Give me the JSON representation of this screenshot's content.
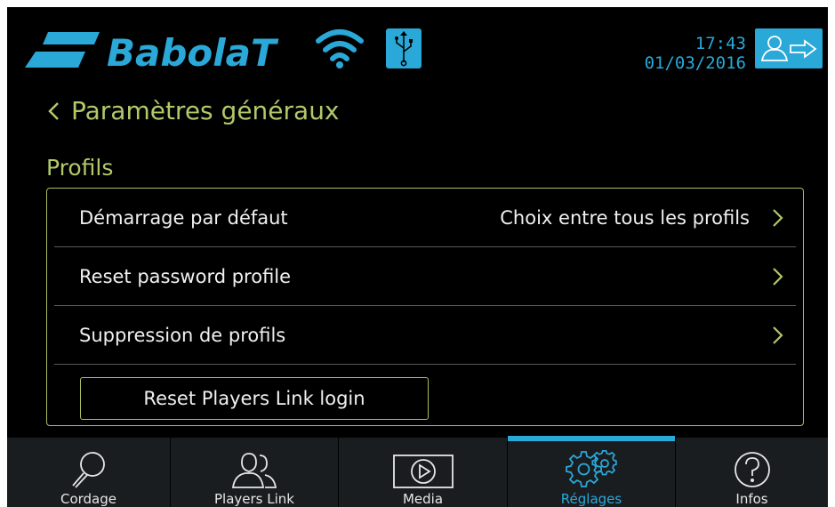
{
  "header": {
    "brand": "BabolaT",
    "time": "17:43",
    "date": "01/03/2016",
    "icons": [
      "babolat-logo",
      "wifi-icon",
      "usb-icon",
      "logout-icon"
    ]
  },
  "title": {
    "back_label": "Paramètres généraux"
  },
  "section": {
    "label": "Profils"
  },
  "settings": [
    {
      "label": "Démarrage par défaut",
      "value": "Choix entre tous les profils"
    },
    {
      "label": "Reset password profile",
      "value": ""
    },
    {
      "label": "Suppression de profils",
      "value": ""
    }
  ],
  "reset_button": "Reset Players Link login",
  "nav": {
    "items": [
      {
        "label": "Cordage",
        "icon": "racket-icon",
        "active": false
      },
      {
        "label": "Players Link",
        "icon": "players-icon",
        "active": false
      },
      {
        "label": "Media",
        "icon": "play-icon",
        "active": false
      },
      {
        "label": "Réglages",
        "icon": "gears-icon",
        "active": true
      },
      {
        "label": "Infos",
        "icon": "help-icon",
        "active": false
      }
    ]
  },
  "colors": {
    "accent_blue": "#2aa8d8",
    "accent_green": "#b2c86a",
    "background": "#000000",
    "nav_background": "#1a1d20"
  }
}
